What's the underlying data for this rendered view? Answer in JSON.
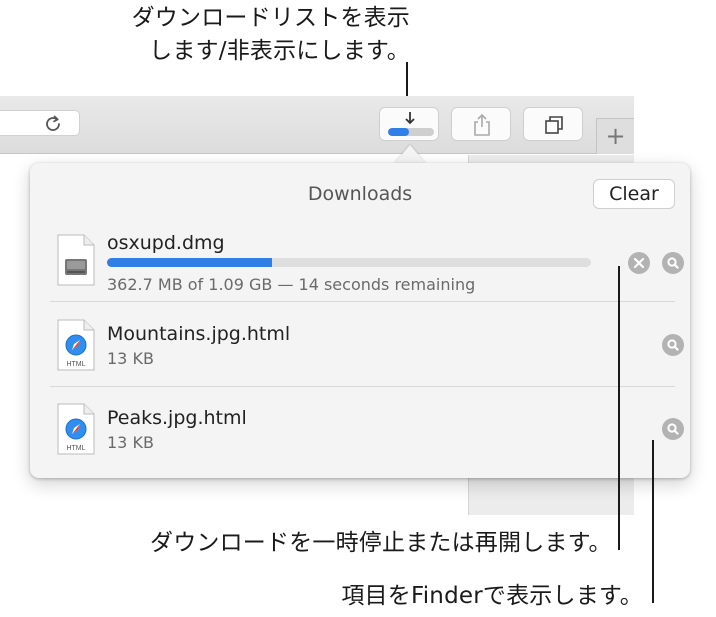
{
  "callouts": {
    "show_hide_line1": "ダウンロードリストを表示",
    "show_hide_line2": "します/非表示にします。",
    "pause_resume": "ダウンロードを一時停止または再開します。",
    "show_in_finder": "項目をFinderで表示します。"
  },
  "toolbar": {
    "download_progress": 0.45,
    "buttons": [
      "reload-icon",
      "download-progress-icon",
      "share-icon",
      "tabs-icon",
      "new-tab-icon"
    ],
    "new_tab_glyph": "+"
  },
  "downloads": {
    "title": "Downloads",
    "clear_label": "Clear",
    "items": [
      {
        "name": "osxupd.dmg",
        "status": "362.7 MB of 1.09 GB — 14 seconds remaining",
        "progress": 0.34,
        "icon": "disk-image-icon",
        "in_progress": true
      },
      {
        "name": "Mountains.jpg.html",
        "status": "13 KB",
        "icon": "html-document-icon",
        "icon_label": "HTML",
        "in_progress": false
      },
      {
        "name": "Peaks.jpg.html",
        "status": "13 KB",
        "icon": "html-document-icon",
        "icon_label": "HTML",
        "in_progress": false
      }
    ]
  },
  "colors": {
    "accent": "#2f7fe6",
    "popover_bg": "#f4f4f4",
    "circle_button": "#b3b3b3"
  }
}
